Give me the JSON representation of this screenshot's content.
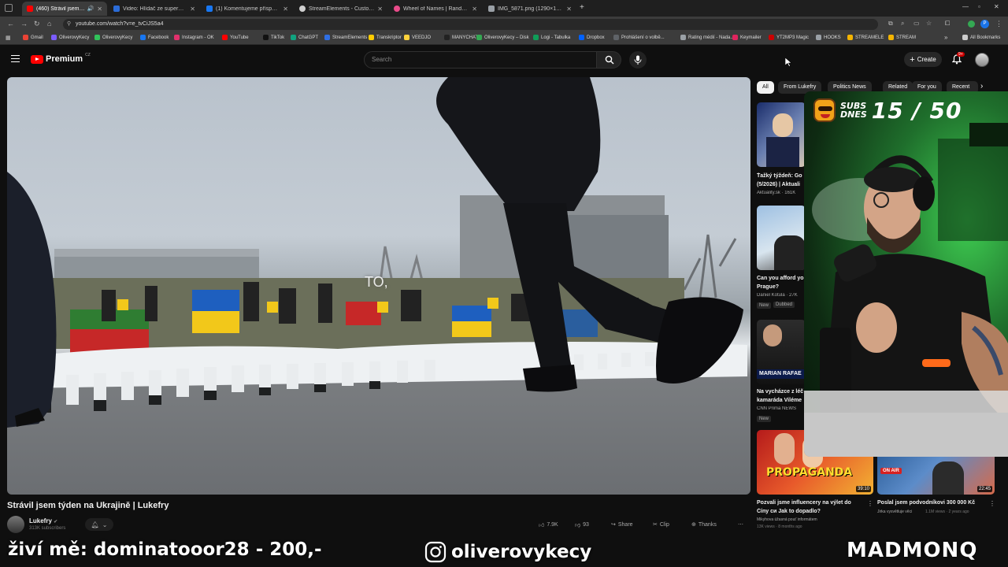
{
  "browser": {
    "tabs": [
      {
        "title": "(460) Strávil jsem týden na",
        "active": true,
        "color": "#ff0000"
      },
      {
        "title": "Video: Hlídač ze supermarketu",
        "active": false,
        "color": "#2b6cd8"
      },
      {
        "title": "(1) Komentujeme příspěvky do",
        "active": false,
        "color": "#1877f2"
      },
      {
        "title": "StreamElements - Custom com",
        "active": false,
        "color": "#cfcfcf"
      },
      {
        "title": "Wheel of Names | Random nam",
        "active": false,
        "color": "#e94b8a"
      },
      {
        "title": "IMG_5871.png (1290×1253)",
        "active": false,
        "color": "#9aa0a6"
      }
    ],
    "url": "youtube.com/watch?v=e_tvCiJS5a4",
    "bookmarks": [
      {
        "label": "Gmail",
        "color": "#ea4335"
      },
      {
        "label": "OliverovyKecy",
        "color": "#7b5cff"
      },
      {
        "label": "OliverovyKecy",
        "color": "#31c25a"
      },
      {
        "label": "Facebook",
        "color": "#1877f2"
      },
      {
        "label": "Instagram - OK",
        "color": "#e1306c"
      },
      {
        "label": "YouTube",
        "color": "#ff0000"
      },
      {
        "label": "TikTok",
        "color": "#111111"
      },
      {
        "label": "ChatGPT",
        "color": "#10a37f"
      },
      {
        "label": "StreamElements",
        "color": "#2f6fe4"
      },
      {
        "label": "Transkriptor",
        "color": "#ffcc00"
      },
      {
        "label": "VEEDJO",
        "color": "#ffd23c"
      },
      {
        "label": "MANYCHAT",
        "color": "#222222"
      },
      {
        "label": "OliverovyKecy – Disk",
        "color": "#34a853"
      },
      {
        "label": "Logi - Tabulka",
        "color": "#0f9d58"
      },
      {
        "label": "Dropbox",
        "color": "#0061fe"
      },
      {
        "label": "Prohlášení o volbě...",
        "color": "#5f6368"
      },
      {
        "label": "Rating médií - Nada...",
        "color": "#9aa0a6"
      },
      {
        "label": "Keymailer",
        "color": "#e0245e"
      },
      {
        "label": "YT2MP3 Magic",
        "color": "#cc0000"
      },
      {
        "label": "HOOKS",
        "color": "#9aa0a6"
      },
      {
        "label": "STREAMELE",
        "color": "#f4b400"
      },
      {
        "label": "STREAM",
        "color": "#f4b400"
      }
    ],
    "all_bookmarks": "All Bookmarks"
  },
  "youtube": {
    "logo_text": "Premium",
    "region": "CZ",
    "search_placeholder": "Search",
    "create_label": "Create",
    "notif_count": "9+"
  },
  "video": {
    "title": "Strávil jsem týden na Ukrajině | Lukefry",
    "subtitle": "TO,",
    "channel": "Lukefry",
    "subscribers": "313K subscribers",
    "likes": "7.9K",
    "dislikes": "93",
    "share": "Share",
    "clip": "Clip",
    "thanks": "Thanks",
    "more": "⋯"
  },
  "chips": [
    "All",
    "From Lukefry",
    "Politics News",
    "Related",
    "For you",
    "Recent"
  ],
  "sidebar": [
    {
      "title": "Ťažký týždeň: Go",
      "title2": "(5/2026) | Aktuali",
      "meta": "Aktuality.sk · 161K",
      "badge": ""
    },
    {
      "title": "Can you afford yo",
      "title2": "Prague?",
      "meta": "Daniel Kotula · 27K",
      "badge": "New",
      "badge2": "Dubbed"
    },
    {
      "title": "Na vycházce z léč",
      "title2": "kamaráda Viléme",
      "meta": "CNN Prima NEWS",
      "badge": "New",
      "thumb_text": "MARIAN RAFAE"
    },
    {
      "title": "Pozvali jsme influencery na výlet do",
      "title2": "Číny си Jak to dopadlo?",
      "meta": "Mikyhova úžasná pouť informátem",
      "meta2": "13K views · 8 months ago",
      "thumb_text": "PROPAGANDA",
      "duration": "39:10"
    },
    {
      "title": "Poslal jsem podvodníkovi 300 000 Kč",
      "meta": "Jirka vysvětluje věci",
      "meta2": "1.1M views · 2 years ago",
      "thumb_text": "ON AIR",
      "duration": "22:45"
    }
  ],
  "overlay": {
    "subs_label_1": "SUBS",
    "subs_label_2": "DNES",
    "subs_count": "15 / 50",
    "donor_text": "živí mě: dominatooor28 - 200,-",
    "instagram_handle": "oliverovykecy",
    "brand": "MADMONQ"
  },
  "colors": {
    "yt_red": "#ff0000",
    "background": "#0f0f0f",
    "webcam_green": "#3fcf52"
  }
}
